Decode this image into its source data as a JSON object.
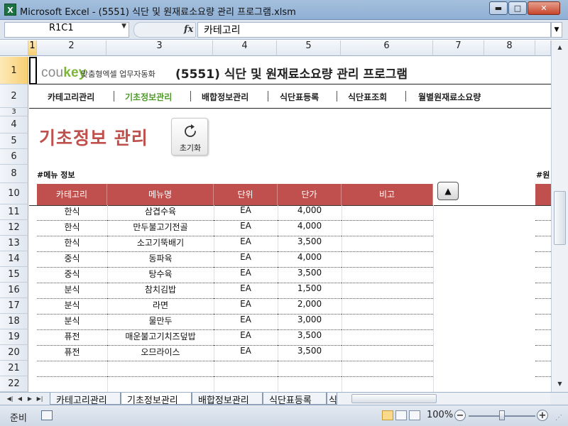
{
  "window": {
    "app_icon": "X",
    "title": "Microsoft Excel - (5551) 식단 및 원재료소요량 관리 프로그램.xlsm",
    "min_label": "▬",
    "max_label": "□",
    "close_label": "✕"
  },
  "formula_bar": {
    "name_box": "R1C1",
    "fx_label": "fx",
    "formula": "카테고리"
  },
  "columns": [
    "1",
    "2",
    "3",
    "4",
    "5",
    "6",
    "7",
    "8"
  ],
  "rows": [
    "1",
    "2",
    "3",
    "4",
    "5",
    "6",
    "8",
    "10",
    "11",
    "12",
    "13",
    "14",
    "15",
    "16",
    "17",
    "18",
    "19",
    "20",
    "21",
    "22"
  ],
  "header": {
    "logo_cou": "cou",
    "logo_key": "key",
    "tagline": "맞춤형엑셀 업무자동화",
    "title": "(5551) 식단 및 원재료소요량 관리 프로그램"
  },
  "nav": [
    {
      "label": "카테고리관리"
    },
    {
      "label": "기초정보관리"
    },
    {
      "label": "배합정보관리"
    },
    {
      "label": "식단표등록"
    },
    {
      "label": "식단표조회"
    },
    {
      "label": "월별원재료소요량"
    }
  ],
  "page": {
    "heading": "기초정보 관리",
    "reset_label": "초기화",
    "section_title": "#메뉴 정보",
    "section_title_right": "#원"
  },
  "table": {
    "headers": [
      "카테고리",
      "메뉴명",
      "단위",
      "단가",
      "비고"
    ],
    "rows": [
      [
        "한식",
        "삼겹수육",
        "EA",
        "4,000",
        ""
      ],
      [
        "한식",
        "만두불고기전골",
        "EA",
        "4,000",
        ""
      ],
      [
        "한식",
        "소고기뚝배기",
        "EA",
        "3,500",
        ""
      ],
      [
        "중식",
        "동파육",
        "EA",
        "4,000",
        ""
      ],
      [
        "중식",
        "탕수육",
        "EA",
        "3,500",
        ""
      ],
      [
        "분식",
        "참치김밥",
        "EA",
        "1,500",
        ""
      ],
      [
        "분식",
        "라면",
        "EA",
        "2,000",
        ""
      ],
      [
        "분식",
        "물만두",
        "EA",
        "3,000",
        ""
      ],
      [
        "퓨전",
        "매운불고기치즈덮밥",
        "EA",
        "3,500",
        ""
      ],
      [
        "퓨전",
        "오므라이스",
        "EA",
        "3,500",
        ""
      ],
      [
        "",
        "",
        "",
        "",
        ""
      ],
      [
        "",
        "",
        "",
        "",
        ""
      ]
    ]
  },
  "sheet_tabs": [
    "카테고리관리",
    "기초정보관리",
    "배합정보관리",
    "식단표등록",
    "식"
  ],
  "status": {
    "ready": "준비",
    "zoom": "100%",
    "zoom_fraction": 0.5
  },
  "colors": {
    "accent_red": "#c0504d",
    "nav_active": "#4f9a2a",
    "logo_green": "#7ab535"
  }
}
